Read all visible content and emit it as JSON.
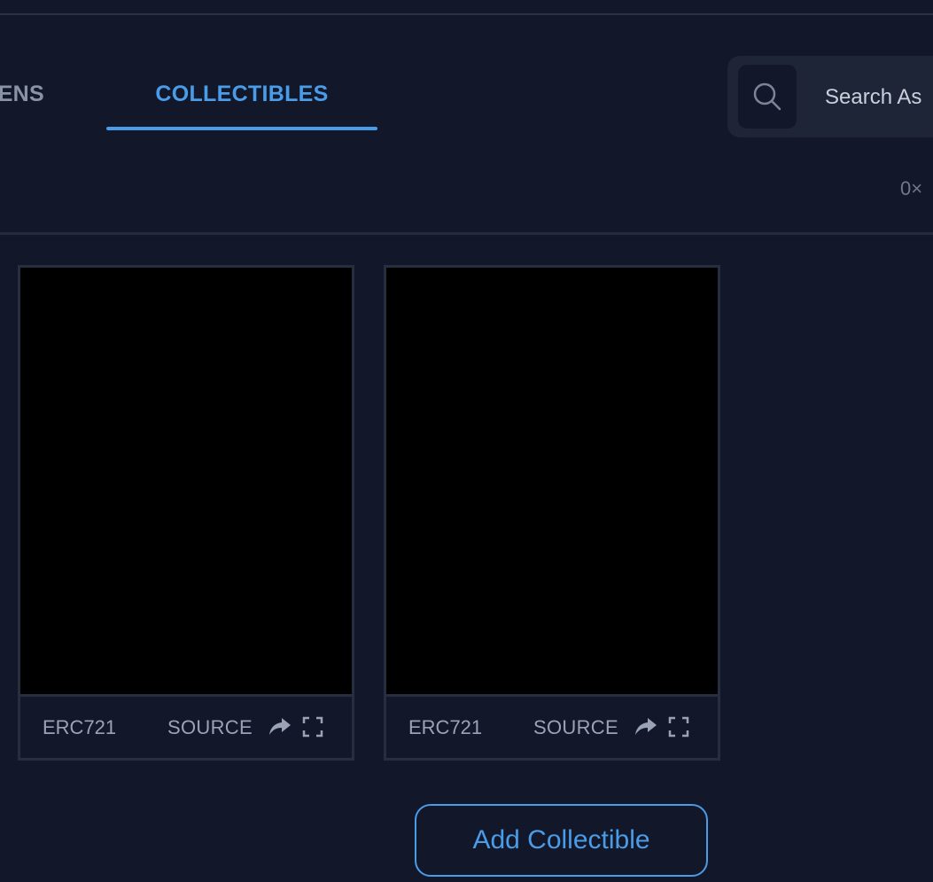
{
  "tabs": [
    {
      "label": "ENS"
    },
    {
      "label": "COLLECTIBLES"
    }
  ],
  "search": {
    "placeholder": "Search As"
  },
  "address": "0×",
  "collectibles": [
    {
      "type": "ERC721",
      "source_label": "SOURCE"
    },
    {
      "type": "ERC721",
      "source_label": "SOURCE"
    }
  ],
  "add_button_label": "Add Collectible",
  "colors": {
    "accent": "#4a9be8",
    "background": "#121829",
    "card_border": "#262e40"
  },
  "icons": [
    "search-icon",
    "share-icon",
    "expand-icon"
  ]
}
